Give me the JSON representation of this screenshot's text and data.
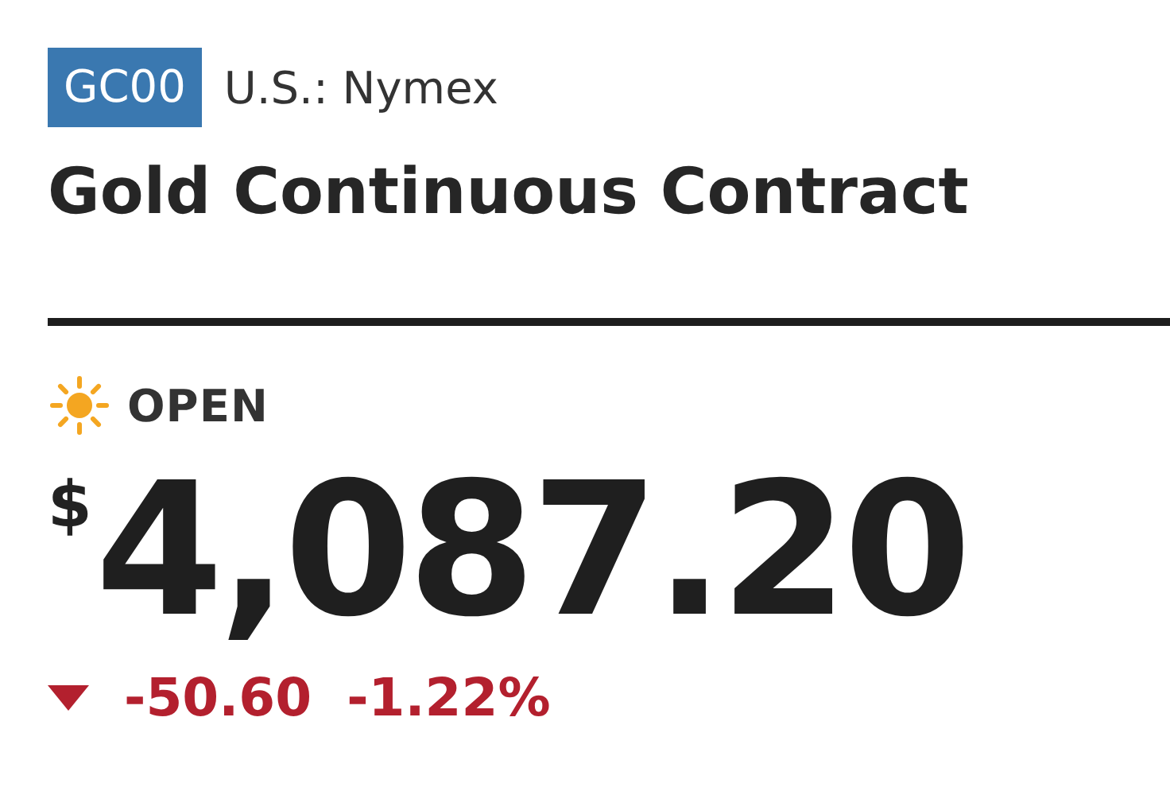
{
  "quote": {
    "symbol": "GC00",
    "exchange": "U.S.: Nymex",
    "title": "Gold Continuous Contract"
  },
  "market_status": {
    "open": true,
    "label": "OPEN"
  },
  "price": {
    "currency": "$",
    "value": "4,087.20"
  },
  "change": {
    "down": true,
    "amount": "-50.60",
    "percent": "-1.22%"
  }
}
